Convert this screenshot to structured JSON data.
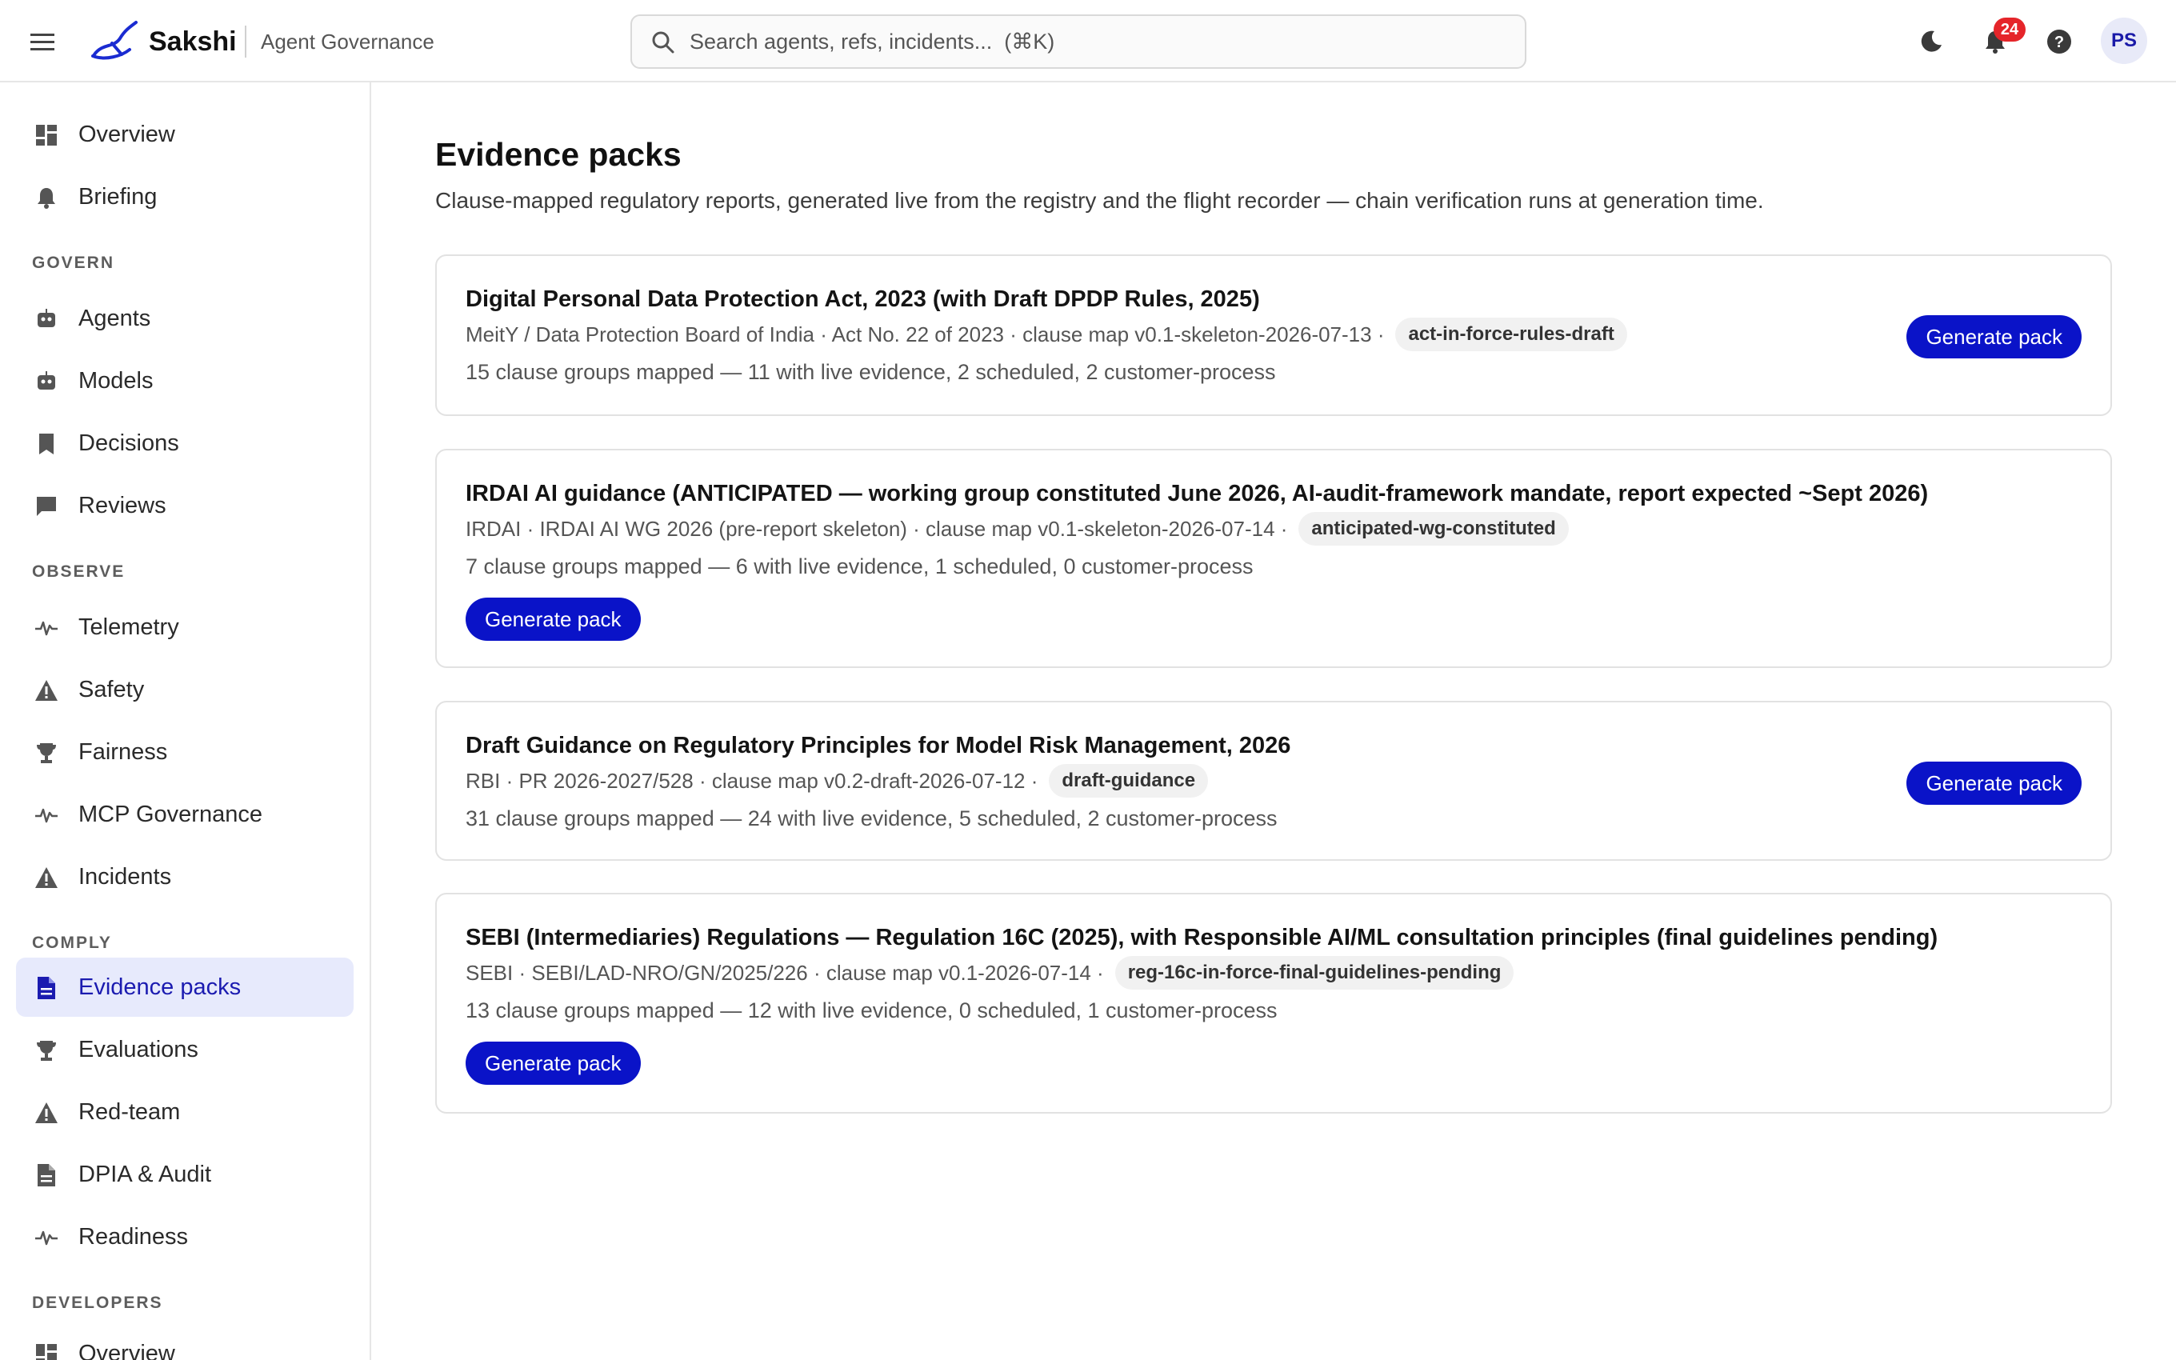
{
  "header": {
    "brand": "Sakshi",
    "subtitle": "Agent Governance",
    "search_placeholder": "Search agents, refs, incidents...  (⌘K)",
    "notifications_count": "24",
    "avatar_initials": "PS"
  },
  "sidebar": {
    "top_items": [
      {
        "label": "Overview",
        "icon": "dashboard-icon"
      },
      {
        "label": "Briefing",
        "icon": "bell-icon"
      }
    ],
    "sections": [
      {
        "heading": "GOVERN",
        "items": [
          {
            "label": "Agents",
            "icon": "robot-icon"
          },
          {
            "label": "Models",
            "icon": "robot-icon"
          },
          {
            "label": "Decisions",
            "icon": "bookmark-icon"
          },
          {
            "label": "Reviews",
            "icon": "chat-icon"
          }
        ]
      },
      {
        "heading": "OBSERVE",
        "items": [
          {
            "label": "Telemetry",
            "icon": "pulse-icon"
          },
          {
            "label": "Safety",
            "icon": "warning-icon"
          },
          {
            "label": "Fairness",
            "icon": "trophy-icon"
          },
          {
            "label": "MCP Governance",
            "icon": "pulse-icon"
          },
          {
            "label": "Incidents",
            "icon": "warning-icon"
          }
        ]
      },
      {
        "heading": "COMPLY",
        "items": [
          {
            "label": "Evidence packs",
            "icon": "document-icon",
            "active": true
          },
          {
            "label": "Evaluations",
            "icon": "trophy-icon"
          },
          {
            "label": "Red-team",
            "icon": "warning-icon"
          },
          {
            "label": "DPIA & Audit",
            "icon": "document-icon"
          },
          {
            "label": "Readiness",
            "icon": "pulse-icon"
          }
        ]
      },
      {
        "heading": "DEVELOPERS",
        "items": [
          {
            "label": "Overview",
            "icon": "dashboard-icon"
          }
        ]
      }
    ]
  },
  "page": {
    "title": "Evidence packs",
    "subtitle": "Clause-mapped regulatory reports, generated live from the registry and the flight recorder — chain verification runs at generation time."
  },
  "packs": [
    {
      "title": "Digital Personal Data Protection Act, 2023 (with Draft DPDP Rules, 2025)",
      "meta": "MeitY / Data Protection Board of India · Act No. 22 of 2023 · clause map v0.1-skeleton-2026-07-13 ·",
      "tag": "act-in-force-rules-draft",
      "summary": "15 clause groups mapped — 11 with live evidence, 2 scheduled, 2 customer-process",
      "button": "Generate pack"
    },
    {
      "title": "IRDAI AI guidance (ANTICIPATED — working group constituted June 2026, AI-audit-framework mandate, report expected ~Sept 2026)",
      "meta": "IRDAI · IRDAI AI WG 2026 (pre-report skeleton) · clause map v0.1-skeleton-2026-07-14 ·",
      "tag": "anticipated-wg-constituted",
      "summary": "7 clause groups mapped — 6 with live evidence, 1 scheduled, 0 customer-process",
      "button": "Generate pack"
    },
    {
      "title": "Draft Guidance on Regulatory Principles for Model Risk Management, 2026",
      "meta": "RBI · PR 2026-2027/528 · clause map v0.2-draft-2026-07-12 ·",
      "tag": "draft-guidance",
      "summary": "31 clause groups mapped — 24 with live evidence, 5 scheduled, 2 customer-process",
      "button": "Generate pack"
    },
    {
      "title": "SEBI (Intermediaries) Regulations — Regulation 16C (2025), with Responsible AI/ML consultation principles (final guidelines pending)",
      "meta": "SEBI · SEBI/LAD-NRO/GN/2025/226 · clause map v0.1-2026-07-14 ·",
      "tag": "reg-16c-in-force-final-guidelines-pending",
      "summary": "13 clause groups mapped — 12 with live evidence, 0 scheduled, 1 customer-process",
      "button": "Generate pack"
    }
  ],
  "colors": {
    "accent": "#0a13c8",
    "active_bg": "#e7eafc",
    "badge": "#e5252a"
  }
}
